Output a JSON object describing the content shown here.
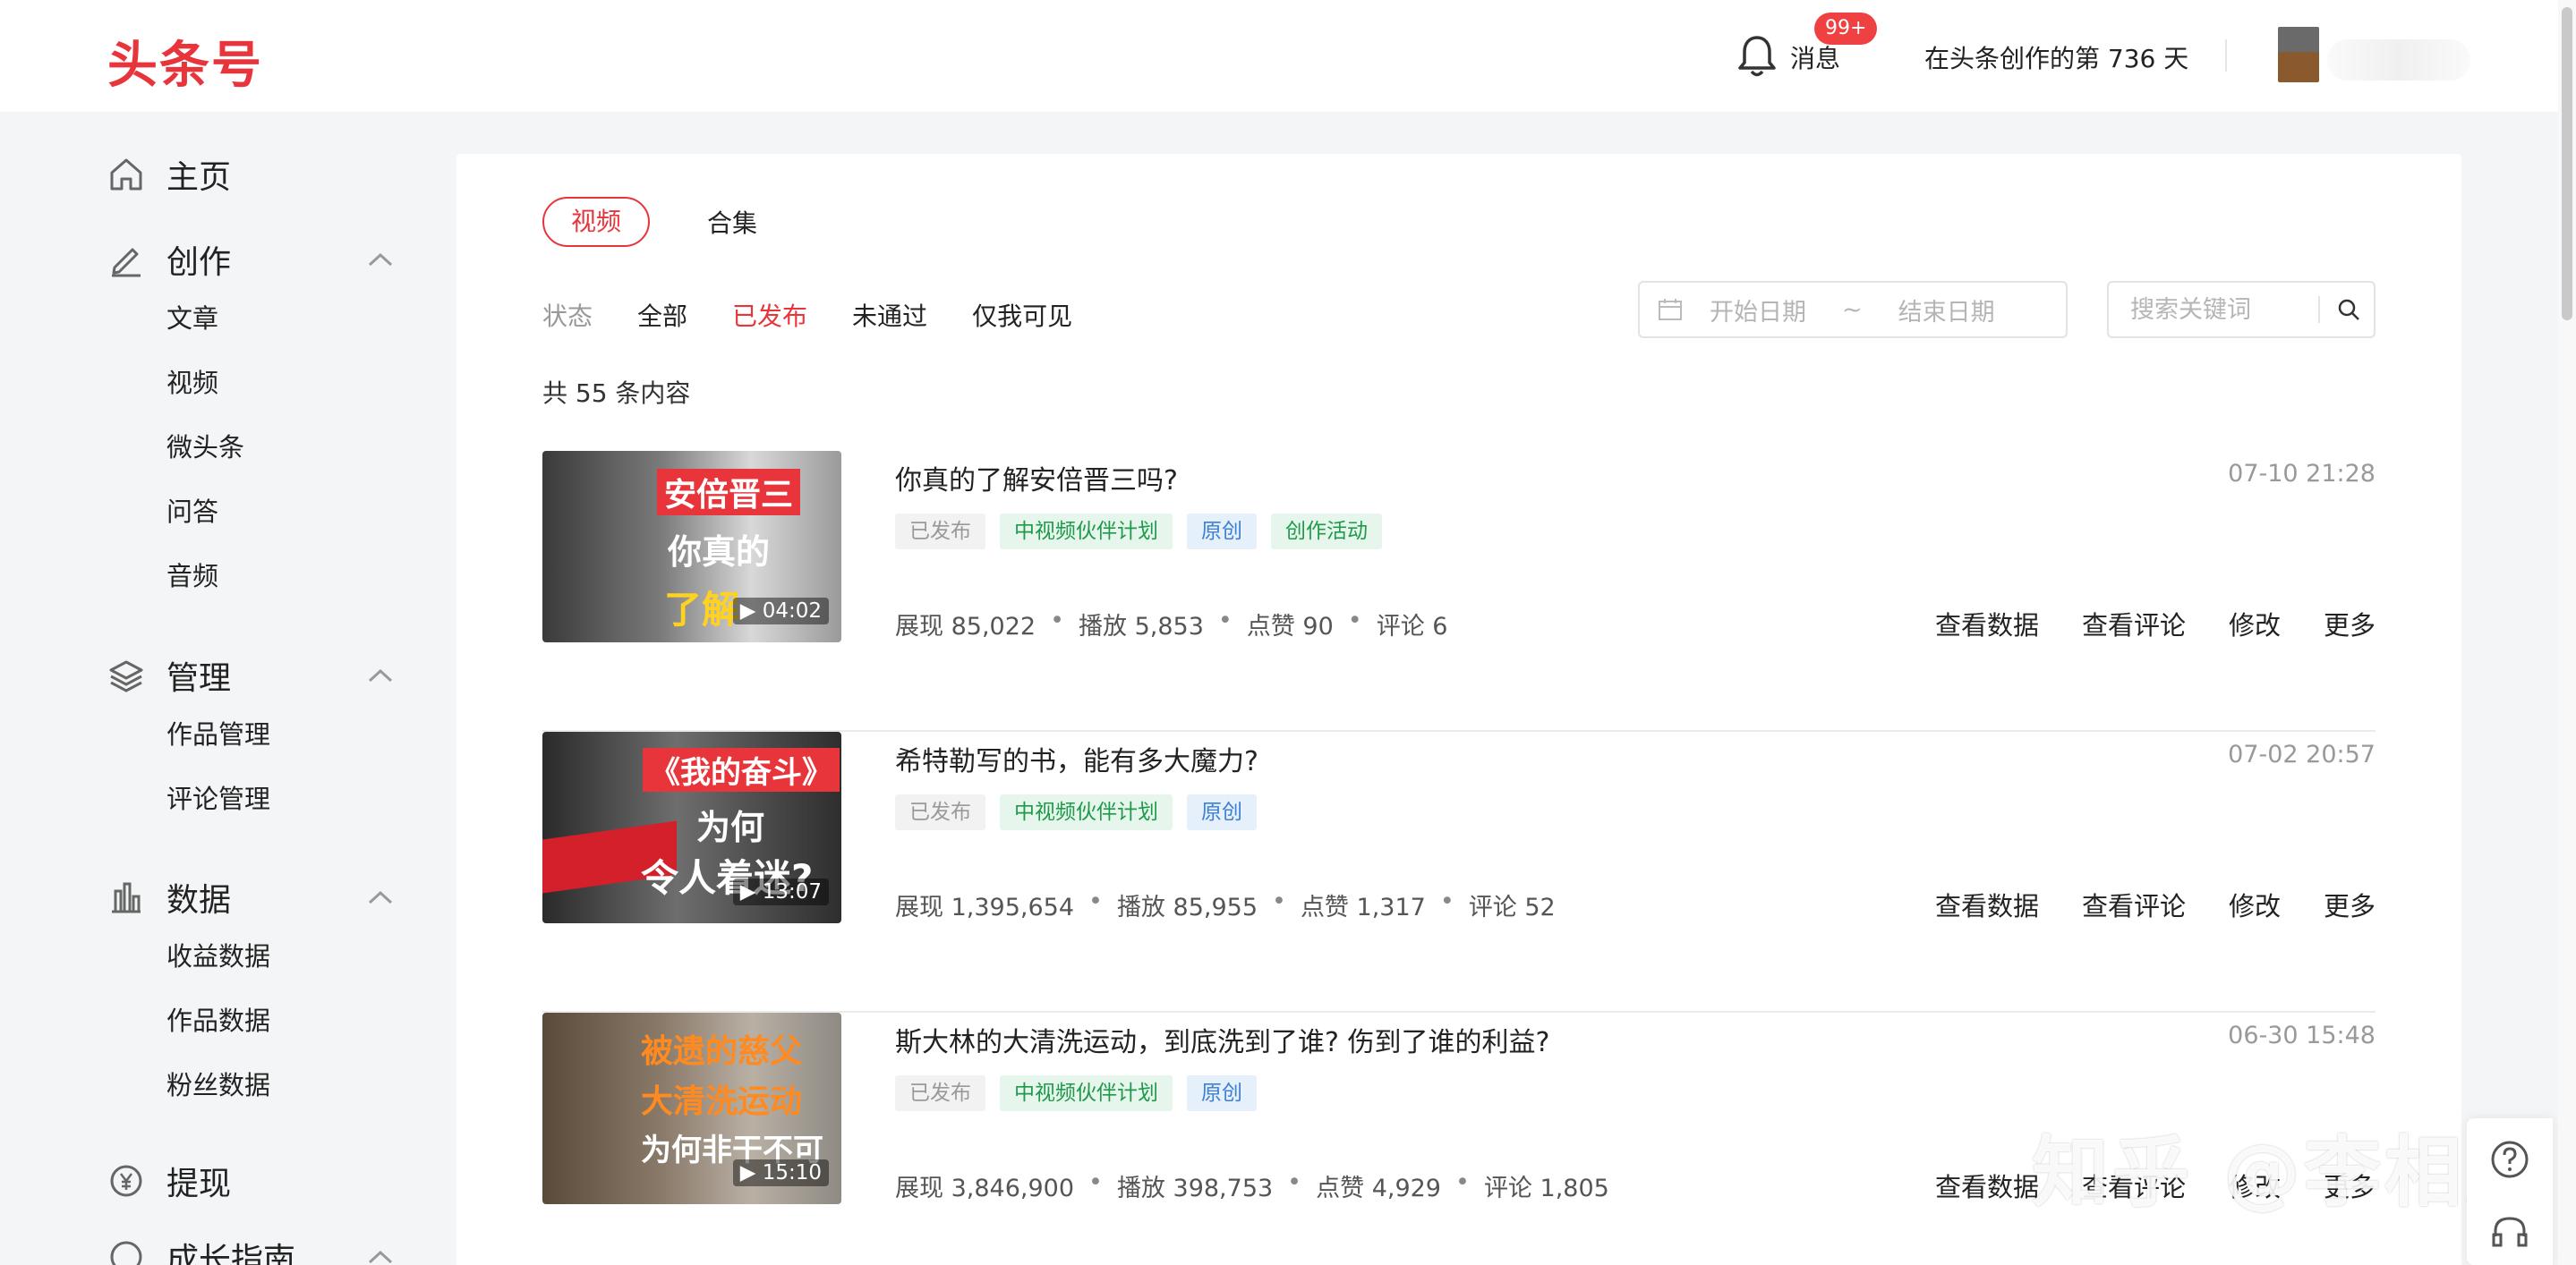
{
  "header": {
    "logo": "头条号",
    "notification_label": "消息",
    "notification_badge": "99+",
    "creation_days": "在头条创作的第 736 天"
  },
  "sidebar": {
    "home": "主页",
    "create": {
      "label": "创作",
      "items": [
        "文章",
        "视频",
        "微头条",
        "问答",
        "音频"
      ]
    },
    "manage": {
      "label": "管理",
      "items": [
        "作品管理",
        "评论管理"
      ]
    },
    "data": {
      "label": "数据",
      "items": [
        "收益数据",
        "作品数据",
        "粉丝数据"
      ]
    },
    "withdraw": "提现",
    "growth": "成长指南"
  },
  "tabs": {
    "video": "视频",
    "collection": "合集"
  },
  "filters": {
    "label": "状态",
    "all": "全部",
    "published": "已发布",
    "failed": "未通过",
    "private": "仅我可见"
  },
  "date_range": {
    "start_placeholder": "开始日期",
    "separator": "~",
    "end_placeholder": "结束日期"
  },
  "search": {
    "placeholder": "搜索关键词"
  },
  "total": "共 55 条内容",
  "items": [
    {
      "title": "你真的了解安倍晋三吗?",
      "time": "07-10 21:28",
      "thumb_text": [
        "安倍晋三",
        "你真的",
        "了解"
      ],
      "duration": "▶ 04:02",
      "tags": [
        "已发布",
        "中视频伙伴计划",
        "原创",
        "创作活动"
      ],
      "stats": [
        "展现 85,022",
        "播放 5,853",
        "点赞 90",
        "评论 6"
      ]
    },
    {
      "title": "希特勒写的书，能有多大魔力?",
      "time": "07-02 20:57",
      "thumb_text": [
        "《我的奋斗》",
        "为何",
        "令人着迷?"
      ],
      "duration": "▶ 13:07",
      "tags": [
        "已发布",
        "中视频伙伴计划",
        "原创"
      ],
      "stats": [
        "展现 1,395,654",
        "播放 85,955",
        "点赞 1,317",
        "评论 52"
      ]
    },
    {
      "title": "斯大林的大清洗运动，到底洗到了谁? 伤到了谁的利益?",
      "time": "06-30 15:48",
      "thumb_text": [
        "被遗的慈父",
        "大清洗运动",
        "为何非干不可"
      ],
      "duration": "▶ 15:10",
      "tags": [
        "已发布",
        "中视频伙伴计划",
        "原创"
      ],
      "stats": [
        "展现 3,846,900",
        "播放 398,753",
        "点赞 4,929",
        "评论 1,805"
      ]
    }
  ],
  "actions": {
    "view_data": "查看数据",
    "view_comments": "查看评论",
    "edit": "修改",
    "more": "更多"
  },
  "watermark": "知乎 @李相关"
}
